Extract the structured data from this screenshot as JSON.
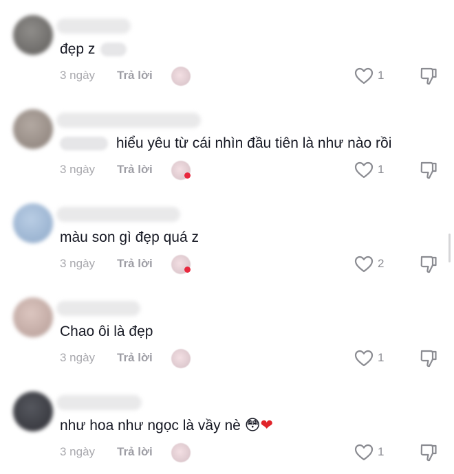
{
  "comments": [
    {
      "text": "đẹp z",
      "time": "3 ngày",
      "reply_label": "Trả lời",
      "likes": "1"
    },
    {
      "text": "hiểu yêu từ cái nhìn đầu tiên là như nào rồi",
      "time": "3 ngày",
      "reply_label": "Trả lời",
      "likes": "1"
    },
    {
      "text": "màu son gì đẹp quá z",
      "time": "3 ngày",
      "reply_label": "Trả lời",
      "likes": "2"
    },
    {
      "text": "Chao ôi là đẹp",
      "time": "3 ngày",
      "reply_label": "Trả lời",
      "likes": "1"
    },
    {
      "text": "như hoa như ngọc là vầy nè",
      "emoji_flushed": "😳",
      "emoji_heart": "❤",
      "time": "3 ngày",
      "reply_label": "Trả lời",
      "likes": "1"
    }
  ],
  "icons": {
    "like": "heart-outline-icon",
    "dislike": "thumbs-down-icon"
  },
  "colors": {
    "text": "#161823",
    "meta": "#a8a8ad",
    "icon": "#8a8b91",
    "creator_heart": "#e8283e"
  }
}
